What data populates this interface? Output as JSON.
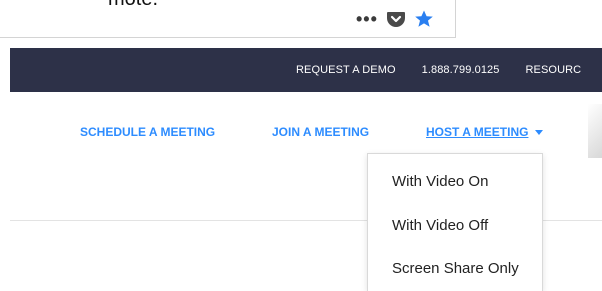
{
  "browser": {
    "cut_text": "mote.",
    "more_icon": "ellipsis-icon",
    "pocket_icon": "pocket-icon",
    "bookmark_icon": "star-icon",
    "colors": {
      "star": "#2a7ff0",
      "pocket": "#4a4a4a"
    }
  },
  "topbar": {
    "links": [
      {
        "label": "REQUEST A DEMO"
      },
      {
        "label": "1.888.799.0125"
      },
      {
        "label": "RESOURC"
      }
    ],
    "background": "#2d3148"
  },
  "nav": {
    "schedule": "SCHEDULE A MEETING",
    "join": "JOIN A MEETING",
    "host": "HOST A MEETING",
    "link_color": "#2d8cff"
  },
  "dropdown": {
    "items": [
      {
        "label": "With Video On"
      },
      {
        "label": "With Video Off"
      },
      {
        "label": "Screen Share Only"
      }
    ]
  }
}
